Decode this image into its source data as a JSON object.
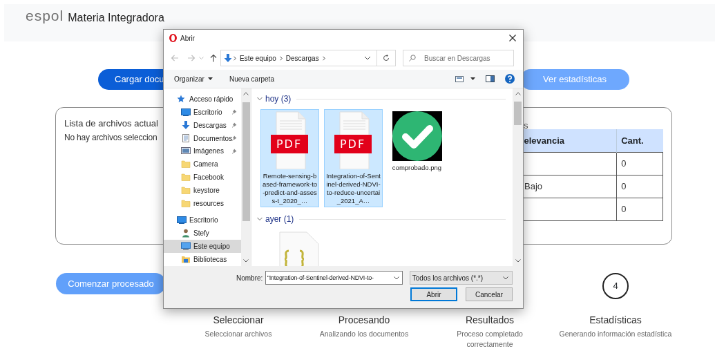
{
  "header": {
    "logo": "espol",
    "title": "Materia Integradora"
  },
  "actions": [
    {
      "label": "Cargar docu",
      "kind": "primary"
    },
    {
      "label": "Ver estadísticas",
      "kind": "light"
    }
  ],
  "files_card": {
    "title": "Lista de archivos actual",
    "empty_message": "No hay archivos seleccion"
  },
  "summary": {
    "title": "s",
    "columns": [
      "elevancia",
      "Cant."
    ],
    "rows": [
      [
        "",
        "0"
      ],
      [
        "Bajo",
        "0"
      ],
      [
        "",
        "0"
      ]
    ]
  },
  "start_button": "Comenzar procesado",
  "steps": [
    {
      "title": "Seleccionar",
      "subtitle": "Seleccionar archivos"
    },
    {
      "title": "Procesando",
      "subtitle": "Analizando los documentos"
    },
    {
      "title": "Resultados",
      "subtitle": "Proceso completado correctamente"
    },
    {
      "number": "4",
      "title": "Estadísticas",
      "subtitle": "Generando información estadística"
    }
  ],
  "dialog": {
    "title": "Abrir",
    "path": [
      "Este equipo",
      "Descargas"
    ],
    "search": {
      "placeholder": "Buscar en Descargas"
    },
    "toolbar": [
      "Organizar",
      "Nueva carpeta"
    ],
    "nav": [
      {
        "label": "Acceso rápido",
        "kind": "star",
        "pinned": false,
        "selected": false,
        "children": [
          {
            "label": "Escritorio",
            "kind": "desktop",
            "pinned": true,
            "selected": false
          },
          {
            "label": "Descargas",
            "kind": "download",
            "pinned": true,
            "selected": false
          },
          {
            "label": "Documentos",
            "kind": "documents",
            "pinned": true,
            "selected": false
          },
          {
            "label": "Imágenes",
            "kind": "images",
            "pinned": true,
            "selected": false
          },
          {
            "label": "Camera",
            "kind": "folder",
            "pinned": false,
            "selected": false
          },
          {
            "label": "Facebook",
            "kind": "folder",
            "pinned": false,
            "selected": false
          },
          {
            "label": "keystore",
            "kind": "folder",
            "pinned": false,
            "selected": false
          },
          {
            "label": "resources",
            "kind": "folder",
            "pinned": false,
            "selected": false
          }
        ]
      },
      {
        "label": "Escritorio",
        "kind": "desktop",
        "pinned": false,
        "selected": false,
        "children": [
          {
            "label": "Stefy",
            "kind": "user",
            "pinned": false,
            "selected": false
          },
          {
            "label": "Este equipo",
            "kind": "computer",
            "pinned": false,
            "selected": true
          },
          {
            "label": "Bibliotecas",
            "kind": "library",
            "pinned": false,
            "selected": false
          }
        ]
      }
    ],
    "groups": [
      {
        "label": "hoy (3)",
        "expanded": true,
        "files": [
          {
            "name": "Remote-sensing-based-framework-to-predict-and-assess-t_2020_…",
            "kind": "pdf",
            "badge": "PDF",
            "selected": true
          },
          {
            "name": "Integration-of-Sentinel-derived-NDVI-to-reduce-uncertai_2021_A…",
            "kind": "pdf",
            "badge": "PDF",
            "selected": true
          },
          {
            "name": "comprobado.png",
            "kind": "image",
            "selected": false
          }
        ]
      },
      {
        "label": "ayer (1)",
        "expanded": true,
        "files": [
          {
            "kind": "json",
            "selected": false
          }
        ]
      }
    ],
    "filename_label": "Nombre:",
    "filename": "\"Integration-of-Sentinel-derived-NDVI-to-",
    "filter": "Todos los archivos (*.*)",
    "buttons": [
      {
        "label": "Abrir",
        "kind": "default"
      },
      {
        "label": "Cancelar",
        "kind": "normal"
      }
    ]
  }
}
